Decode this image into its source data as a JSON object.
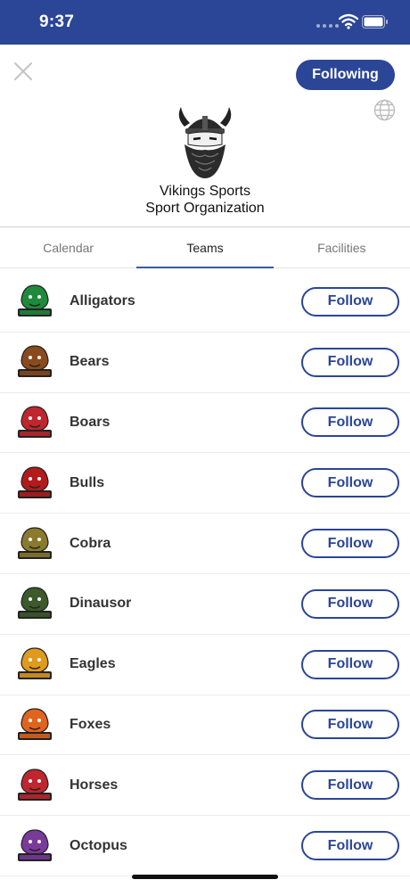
{
  "status_bar": {
    "time": "9:37"
  },
  "header": {
    "following_label": "Following",
    "org_name": "Vikings Sports",
    "org_type": "Sport Organization"
  },
  "tabs": [
    {
      "label": "Calendar"
    },
    {
      "label": "Teams",
      "active": true
    },
    {
      "label": "Facilities"
    }
  ],
  "teams": [
    {
      "name": "Alligators",
      "color": "#1e8a3c",
      "follow_label": "Follow"
    },
    {
      "name": "Bears",
      "color": "#8a4a1e",
      "follow_label": "Follow"
    },
    {
      "name": "Boars",
      "color": "#c0262e",
      "follow_label": "Follow"
    },
    {
      "name": "Bulls",
      "color": "#b31b1b",
      "follow_label": "Follow"
    },
    {
      "name": "Cobra",
      "color": "#8a7a2e",
      "follow_label": "Follow"
    },
    {
      "name": "Dinausor",
      "color": "#3c5a2a",
      "follow_label": "Follow"
    },
    {
      "name": "Eagles",
      "color": "#e09a1e",
      "follow_label": "Follow"
    },
    {
      "name": "Foxes",
      "color": "#e0641e",
      "follow_label": "Follow"
    },
    {
      "name": "Horses",
      "color": "#c0262e",
      "follow_label": "Follow"
    },
    {
      "name": "Octopus",
      "color": "#7a3a9a",
      "follow_label": "Follow"
    }
  ],
  "colors": {
    "brand": "#2b4597"
  }
}
